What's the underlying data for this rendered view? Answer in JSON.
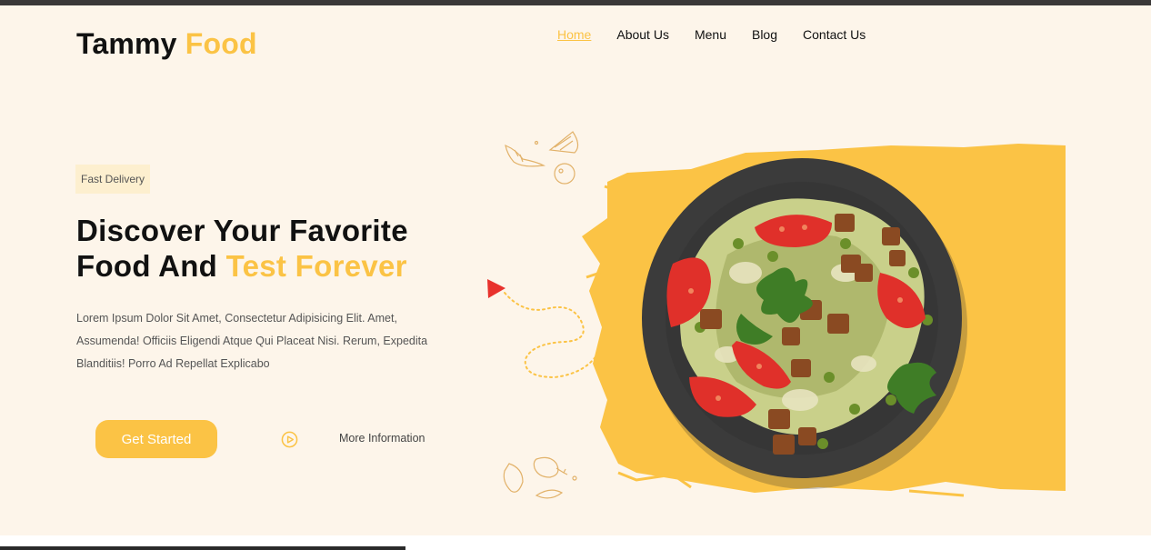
{
  "brand": {
    "name": "Tammy",
    "accent_name": "Food"
  },
  "nav": {
    "items": [
      {
        "label": "Home",
        "active": true
      },
      {
        "label": "About Us",
        "active": false
      },
      {
        "label": "Menu",
        "active": false
      },
      {
        "label": "Blog",
        "active": false
      },
      {
        "label": "Contact Us",
        "active": false
      }
    ]
  },
  "hero": {
    "badge": "Fast Delivery",
    "headline_line1": "Discover Your Favorite",
    "headline_line2_plain": "Food And",
    "headline_line2_accent": "Test Forever",
    "description": "Lorem Ipsum Dolor Sit Amet, Consectetur Adipisicing Elit. Amet, Assumenda! Officiis Eligendi Atque Qui Placeat Nisi. Rerum, Expedita Blanditiis! Porro Ad Repellat Explicabo",
    "cta_primary": "Get Started",
    "cta_secondary": "More Information"
  },
  "icons": {
    "play": "play-circle-icon",
    "arrow": "red-arrow-icon"
  },
  "colors": {
    "accent": "#fbc345",
    "background": "#fdf5ea",
    "plate": "#3b3b3b",
    "arrow": "#e8322d"
  }
}
